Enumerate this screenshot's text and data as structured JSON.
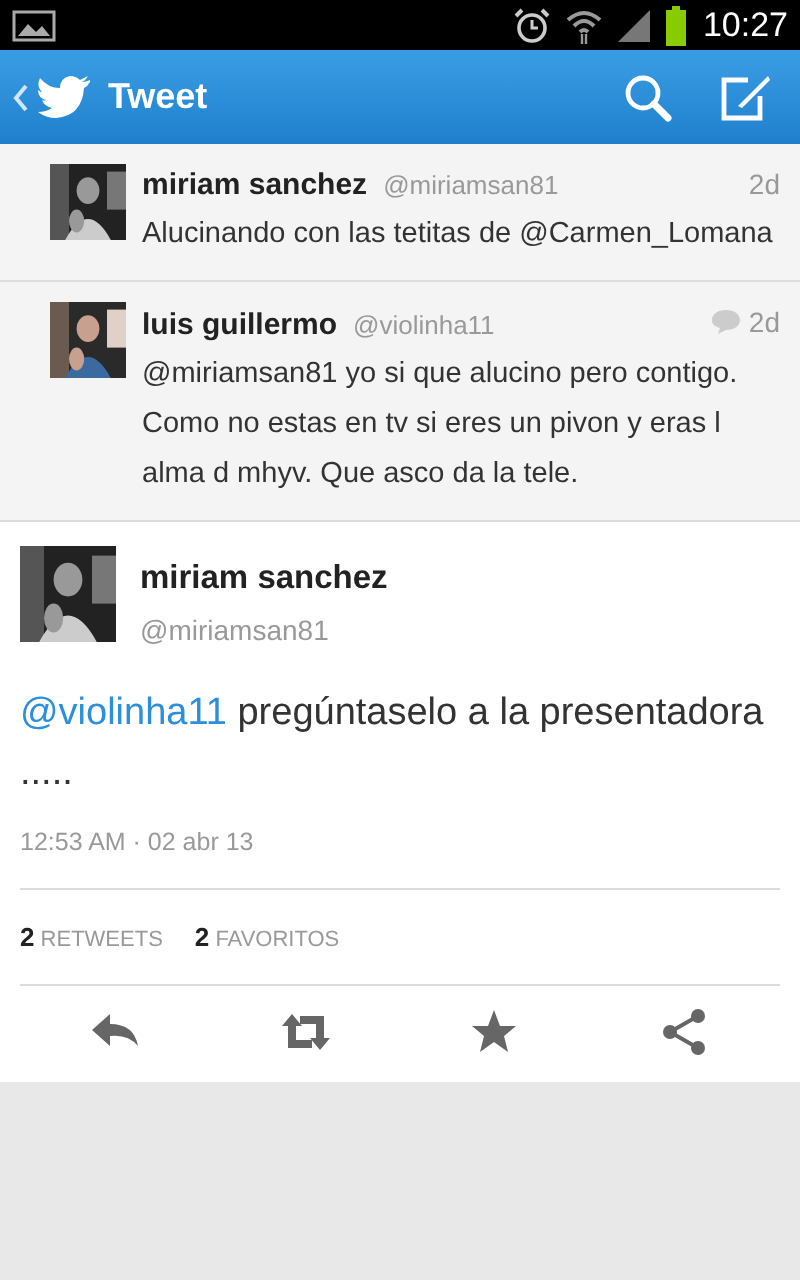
{
  "status_bar": {
    "time": "10:27"
  },
  "app_bar": {
    "title": "Tweet"
  },
  "replies": [
    {
      "name": "miriam sanchez",
      "handle": "@miriamsan81",
      "age": "2d",
      "conversation": false,
      "text": "Alucinando con las tetitas de @Carmen_Lomana"
    },
    {
      "name": "luis guillermo",
      "handle": "@violinha11",
      "age": "2d",
      "conversation": true,
      "text": "@miriamsan81 yo si que alucino pero contigo. Como no estas en tv si eres un pivon y eras l alma d mhyv. Que asco da la tele."
    }
  ],
  "tweet": {
    "name": "miriam sanchez",
    "handle": "@miriamsan81",
    "mention": "@violinha11",
    "text": "pregúntaselo a la presentadora .....",
    "timestamp": "12:53 AM · 02 abr 13",
    "stats": [
      {
        "count": "2",
        "label": "RETWEETS"
      },
      {
        "count": "2",
        "label": "FAVORITOS"
      }
    ],
    "actions": [
      {
        "kind": "reply"
      },
      {
        "kind": "retweet"
      },
      {
        "kind": "favorite"
      },
      {
        "kind": "share"
      }
    ]
  }
}
